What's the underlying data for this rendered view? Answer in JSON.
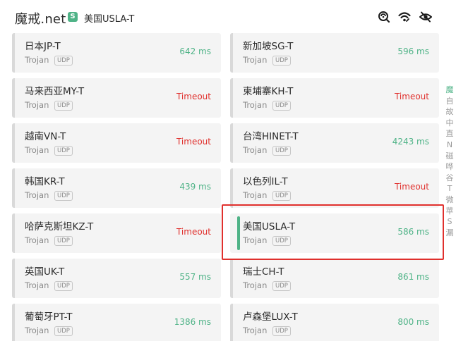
{
  "header": {
    "title": "魔戒.net",
    "group_badge": "S",
    "group_name": "美国USLA-T"
  },
  "proxies": [
    {
      "name": "日本JP-T",
      "protocol": "Trojan",
      "tag": "UDP",
      "delay": "642 ms",
      "status": "ok"
    },
    {
      "name": "新加坡SG-T",
      "protocol": "Trojan",
      "tag": "UDP",
      "delay": "596 ms",
      "status": "ok"
    },
    {
      "name": "马来西亚MY-T",
      "protocol": "Trojan",
      "tag": "UDP",
      "delay": "Timeout",
      "status": "timeout"
    },
    {
      "name": "柬埔寨KH-T",
      "protocol": "Trojan",
      "tag": "UDP",
      "delay": "Timeout",
      "status": "timeout"
    },
    {
      "name": "越南VN-T",
      "protocol": "Trojan",
      "tag": "UDP",
      "delay": "Timeout",
      "status": "timeout"
    },
    {
      "name": "台湾HINET-T",
      "protocol": "Trojan",
      "tag": "UDP",
      "delay": "4243 ms",
      "status": "ok"
    },
    {
      "name": "韩国KR-T",
      "protocol": "Trojan",
      "tag": "UDP",
      "delay": "439 ms",
      "status": "ok"
    },
    {
      "name": "以色列IL-T",
      "protocol": "Trojan",
      "tag": "UDP",
      "delay": "Timeout",
      "status": "timeout"
    },
    {
      "name": "哈萨克斯坦KZ-T",
      "protocol": "Trojan",
      "tag": "UDP",
      "delay": "Timeout",
      "status": "timeout"
    },
    {
      "name": "美国USLA-T",
      "protocol": "Trojan",
      "tag": "UDP",
      "delay": "586 ms",
      "status": "ok",
      "selected": true
    },
    {
      "name": "英国UK-T",
      "protocol": "Trojan",
      "tag": "UDP",
      "delay": "557 ms",
      "status": "ok"
    },
    {
      "name": "瑞士CH-T",
      "protocol": "Trojan",
      "tag": "UDP",
      "delay": "861 ms",
      "status": "ok"
    },
    {
      "name": "葡萄牙PT-T",
      "protocol": "Trojan",
      "tag": "UDP",
      "delay": "1386 ms",
      "status": "ok"
    },
    {
      "name": "卢森堡LUX-T",
      "protocol": "Trojan",
      "tag": "UDP",
      "delay": "800 ms",
      "status": "ok"
    }
  ],
  "index_letters": [
    "魔",
    "自",
    "故",
    "中",
    "直",
    "N",
    "磁",
    "哗",
    "谷",
    "T",
    "微",
    "苹",
    "S",
    "漏"
  ],
  "colors": {
    "accent": "#4fb387",
    "timeout": "#e0302d",
    "card_bg": "#f4f4f4",
    "highlight_box": "#e0302d"
  },
  "icons": [
    "network-check-icon",
    "wifi-icon",
    "eye-slash-icon"
  ]
}
